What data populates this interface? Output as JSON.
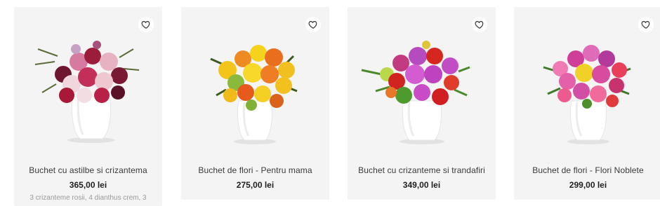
{
  "products": [
    {
      "title": "Buchet cu astilbe si crizantema",
      "price": "365,00 lei",
      "description": "3 crizanteme rosii, 4 dianthus crem, 3",
      "favorite_icon": "heart-outline-icon",
      "image": "bouquet-burgundy-pink-white-vase"
    },
    {
      "title": "Buchet de flori - Pentru mama",
      "price": "275,00 lei",
      "favorite_icon": "heart-outline-icon",
      "image": "bouquet-yellow-orange-white-vase"
    },
    {
      "title": "Buchet cu crizanteme si trandafiri",
      "price": "349,00 lei",
      "favorite_icon": "heart-outline-icon",
      "image": "bouquet-purple-red-green-white-vase"
    },
    {
      "title": "Buchet de flori - Flori Noblete",
      "price": "299,00 lei",
      "favorite_icon": "heart-outline-icon",
      "image": "bouquet-pink-magenta-white-vase"
    }
  ],
  "colors": {
    "card_bg": "#f4f4f4",
    "title": "#3a3a3a",
    "price": "#1f1f1f",
    "description": "#9a9a9a"
  }
}
